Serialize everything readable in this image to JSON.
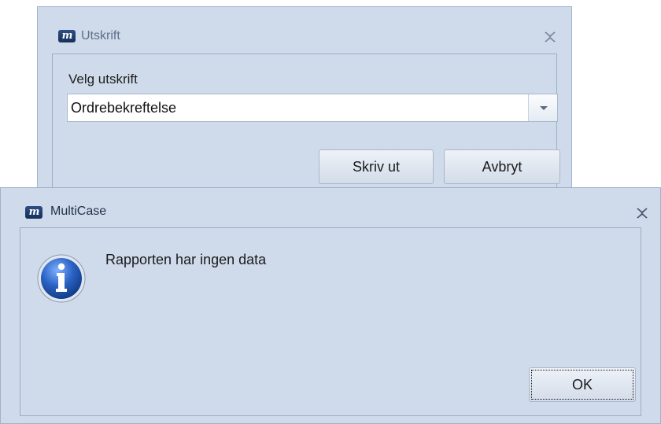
{
  "print_window": {
    "title": "Utskrift",
    "field_label": "Velg utskrift",
    "selected_report": "Ordrebekreftelse",
    "print_button": "Skriv ut",
    "cancel_button": "Avbryt"
  },
  "message_dialog": {
    "title": "MultiCase",
    "icon": "info-icon",
    "message": "Rapporten har ingen data",
    "ok_button": "OK"
  },
  "colors": {
    "window_background": "#cfdbeb",
    "app_logo": "#1f3d70",
    "info_icon": "#1f5fc0"
  }
}
